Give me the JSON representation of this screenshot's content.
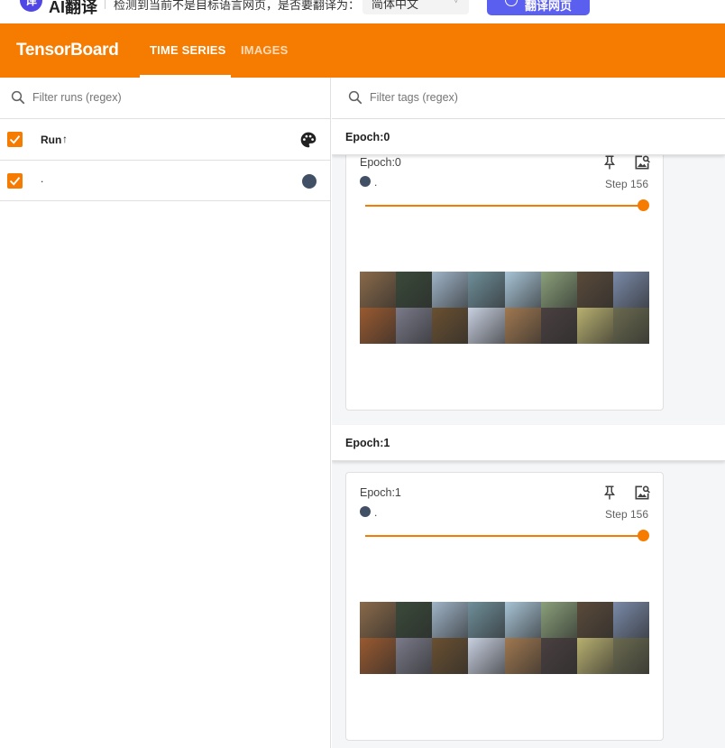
{
  "translate_bar": {
    "logo_text": "译",
    "name": "AI翻译",
    "message": "检测到当前不是目标语言网页，是否要翻译为：",
    "language": "简体中文",
    "button": "翻译网页",
    "accent": "#5b5ff0"
  },
  "header": {
    "brand": "TensorBoard",
    "tabs": [
      {
        "label": "TIME SERIES",
        "active": true
      },
      {
        "label": "IMAGES",
        "active": false
      }
    ],
    "color": "#f57c00"
  },
  "sidebar": {
    "filter_placeholder": "Filter runs (regex)",
    "column_label": "Run",
    "sort_arrow": "↑",
    "runs": [
      {
        "name": ".",
        "checked": true,
        "color": "#425066"
      }
    ]
  },
  "main": {
    "filter_placeholder": "Filter tags (regex)",
    "groups": [
      {
        "title": "Epoch:0",
        "card": {
          "title": "Epoch:0",
          "run": ".",
          "step": "Step 156",
          "slider_fraction": 1.0
        }
      },
      {
        "title": "Epoch:1",
        "card": {
          "title": "Epoch:1",
          "run": ".",
          "step": "Step 156",
          "slider_fraction": 1.0
        }
      }
    ]
  },
  "image_tiles": [
    [
      "#8a6a4a",
      "#3a4a3a",
      "#9fb4c8",
      "#6f8f9a",
      "#a8c4d6",
      "#8aa07a",
      "#5a4a3a",
      "#7a8aa8"
    ],
    [
      "#9a5a30",
      "#7a7a8a",
      "#6a5030",
      "#c8d0e0",
      "#a07850",
      "#4a4040",
      "#b8b070",
      "#6a6a50"
    ]
  ]
}
